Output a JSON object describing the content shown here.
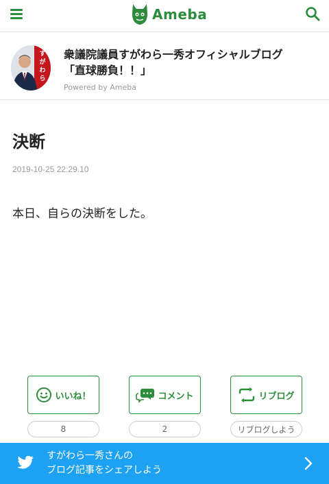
{
  "header": {
    "logo_text": "Ameba"
  },
  "blog": {
    "title_line1": "衆議院議員すがわら一秀オフィシャルブログ",
    "title_line2": "「直球勝負！！」",
    "powered_by": "Powered by Ameba",
    "avatar_banner_text": "すがわら"
  },
  "article": {
    "title": "決断",
    "date": "2019-10-25 22:29.10",
    "body": "本日、自らの決断をした。"
  },
  "actions": {
    "like_label": "いいね！",
    "like_count": "8",
    "comment_label": "コメント",
    "comment_count": "2",
    "reblog_label": "リブログ",
    "reblog_caption": "リブログしよう"
  },
  "share": {
    "line1": "すがわら一秀さんの",
    "line2": "ブログ記事をシェアしよう"
  },
  "colors": {
    "accent": "#2d8c3c",
    "twitter": "#1da1f2"
  }
}
